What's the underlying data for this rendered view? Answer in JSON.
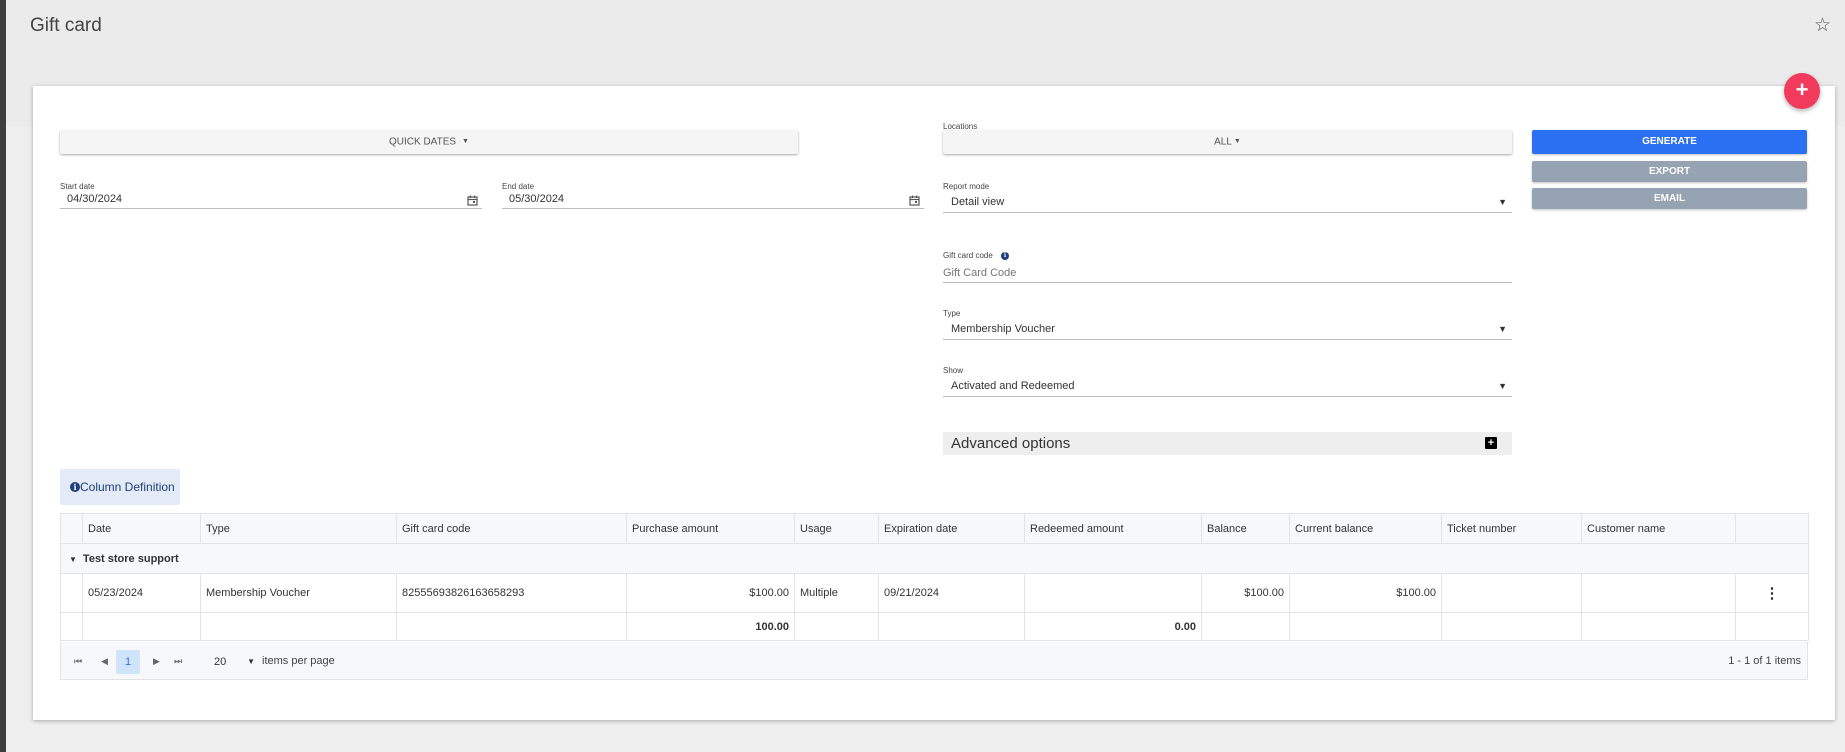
{
  "page": {
    "title": "Gift card"
  },
  "icons": {
    "star": "star-outline-icon",
    "fab": "plus-icon",
    "calendar": "calendar-icon",
    "info": "info-icon"
  },
  "colors": {
    "primary": "#2b6ff2",
    "fab": "#f23a5c",
    "secondary_button": "#95a3b3"
  },
  "filters": {
    "quick_dates_label": "QUICK DATES",
    "locations": {
      "label": "Locations",
      "value": "ALL"
    },
    "start_date": {
      "label": "Start date",
      "value": "04/30/2024"
    },
    "end_date": {
      "label": "End date",
      "value": "05/30/2024"
    },
    "report_mode": {
      "label": "Report mode",
      "value": "Detail view"
    },
    "gift_card_code": {
      "label": "Gift card code",
      "placeholder": "Gift Card Code",
      "value": ""
    },
    "type": {
      "label": "Type",
      "value": "Membership Voucher"
    },
    "show": {
      "label": "Show",
      "value": "Activated and Redeemed"
    },
    "advanced_options_label": "Advanced options"
  },
  "actions": {
    "generate": "GENERATE",
    "export": "EXPORT",
    "email": "EMAIL"
  },
  "column_definition_label": "Column Definition",
  "table": {
    "columns": [
      "Date",
      "Type",
      "Gift card code",
      "Purchase amount",
      "Usage",
      "Expiration date",
      "Redeemed amount",
      "Balance",
      "Current balance",
      "Ticket number",
      "Customer name"
    ],
    "group": {
      "name": "Test store support"
    },
    "rows": [
      {
        "date": "05/23/2024",
        "type": "Membership Voucher",
        "code": "82555693826163658293",
        "purchase_amount": "$100.00",
        "usage": "Multiple",
        "expiration_date": "09/21/2024",
        "redeemed_amount": "",
        "balance": "$100.00",
        "current_balance": "$100.00",
        "ticket_number": "",
        "customer_name": ""
      }
    ],
    "totals": {
      "purchase_amount": "100.00",
      "redeemed_amount": "0.00"
    }
  },
  "pager": {
    "current_page": "1",
    "page_size": "20",
    "items_per_page_label": "items per page",
    "summary": "1 - 1 of 1 items"
  }
}
